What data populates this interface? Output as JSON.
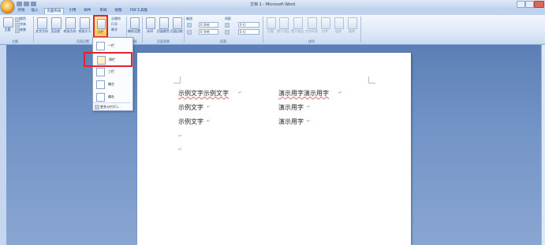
{
  "window": {
    "title": "文档 1 - Microsoft Word"
  },
  "tabs": [
    "开始",
    "插入",
    "页面布局",
    "引用",
    "邮件",
    "审阅",
    "视图",
    "PDF工具集"
  ],
  "active_tab": "页面布局",
  "ribbon": {
    "theme_group": {
      "label": "主题",
      "button": "主题",
      "items": [
        "颜色",
        "字体",
        "效果"
      ]
    },
    "page_setup_group": {
      "label": "页面设置",
      "buttons": [
        "文字方向",
        "页边距",
        "纸张方向",
        "纸张大小",
        "分栏"
      ],
      "side_items": [
        "分隔符",
        "行号",
        "断字"
      ]
    },
    "manuscript_group": {
      "label": "稿纸",
      "button": "稿纸设置"
    },
    "page_bg_group": {
      "label": "页面背景",
      "buttons": [
        "水印",
        "页面颜色",
        "页面边框"
      ]
    },
    "paragraph_group": {
      "label": "段落",
      "indent_label": "缩进",
      "spacing_label": "间距",
      "indent_left": "0 字符",
      "indent_right": "0 字符",
      "spacing_before": "0 行",
      "spacing_after": "0 行"
    },
    "arrange_group": {
      "label": "排列",
      "buttons": [
        "位置",
        "置于顶层",
        "置于底层",
        "文字环绕",
        "对齐",
        "组合",
        "旋转"
      ]
    }
  },
  "columns_menu": {
    "items": [
      "一栏",
      "两栏",
      "三栏",
      "偏左",
      "偏右"
    ],
    "more": "更多分栏(C)...",
    "highlighted": "两栏"
  },
  "document": {
    "left_column": [
      "示例文字示例文字",
      "示例文字",
      "示例文字"
    ],
    "right_column": [
      "演示用字演示用字",
      "演示用字",
      "演示用字"
    ]
  },
  "colors": {
    "highlight": "#e2232b",
    "accent": "#15428b"
  }
}
